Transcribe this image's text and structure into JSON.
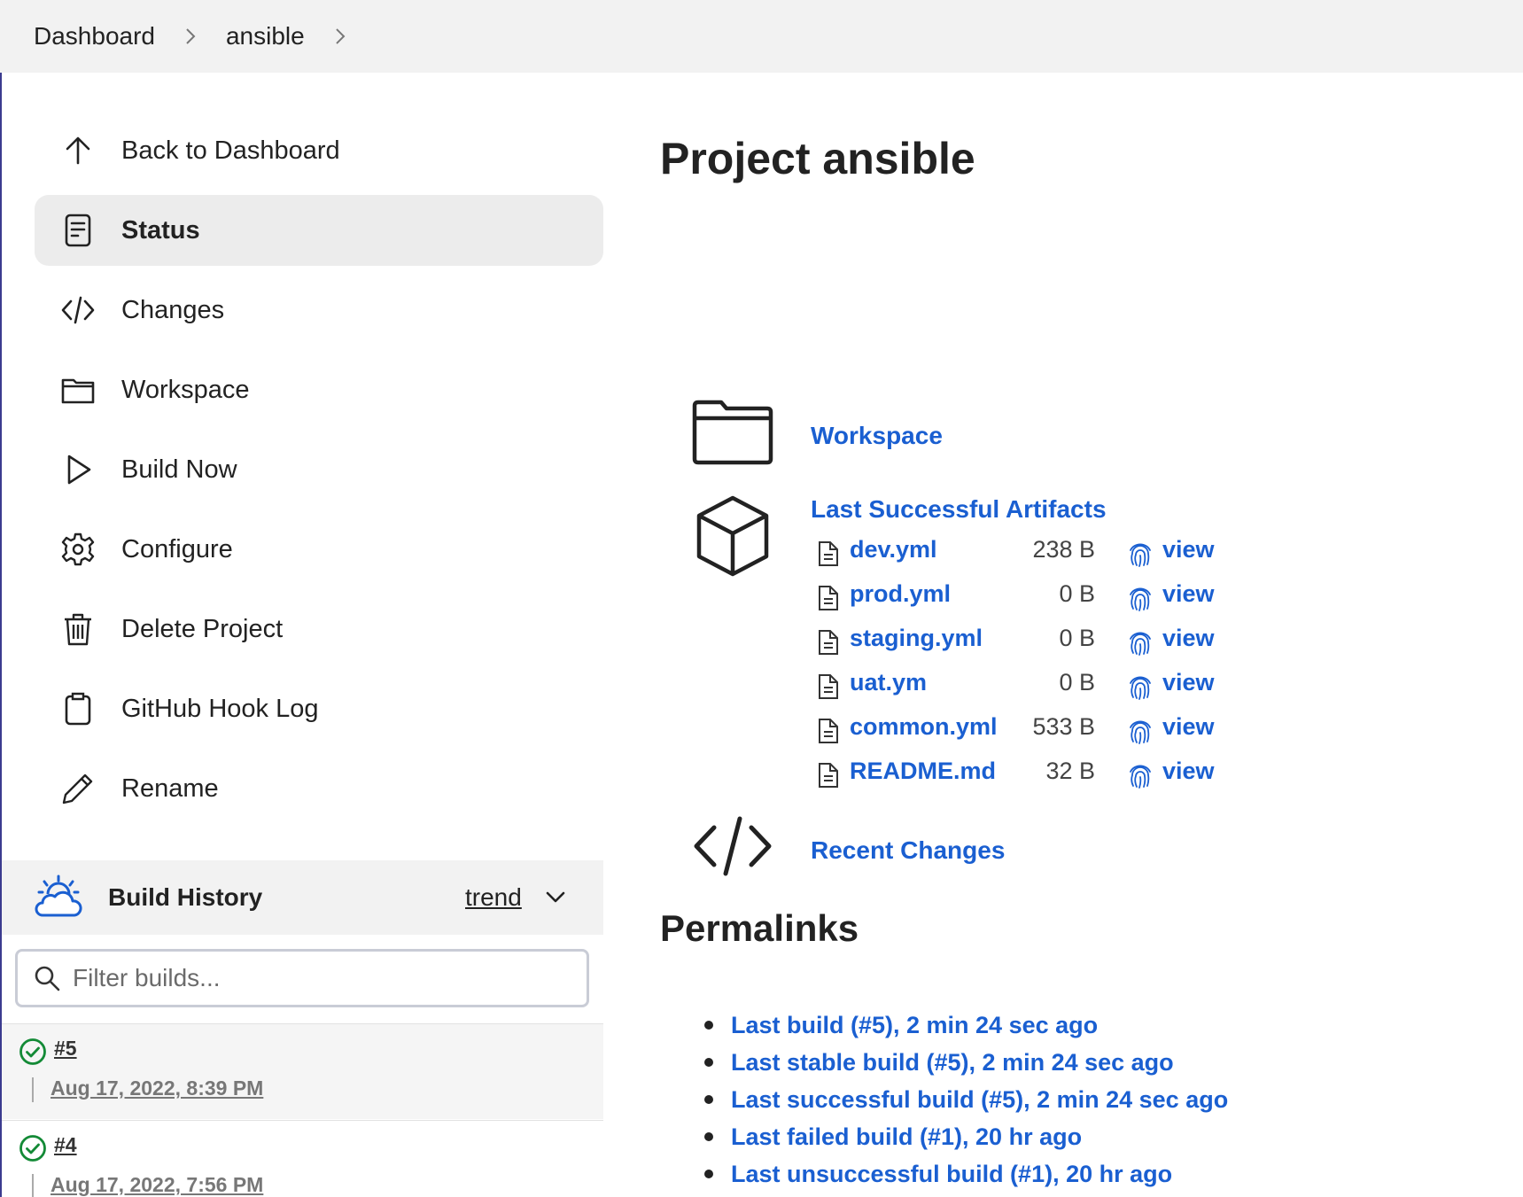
{
  "breadcrumb": {
    "items": [
      "Dashboard",
      "ansible"
    ]
  },
  "sidebar": {
    "items": [
      {
        "label": "Back to Dashboard",
        "icon": "arrow-up-icon"
      },
      {
        "label": "Status",
        "icon": "document-icon",
        "active": true
      },
      {
        "label": "Changes",
        "icon": "code-icon"
      },
      {
        "label": "Workspace",
        "icon": "folder-icon"
      },
      {
        "label": "Build Now",
        "icon": "play-icon"
      },
      {
        "label": "Configure",
        "icon": "gear-icon"
      },
      {
        "label": "Delete Project",
        "icon": "trash-icon"
      },
      {
        "label": "GitHub Hook Log",
        "icon": "clipboard-icon"
      },
      {
        "label": "Rename",
        "icon": "pencil-icon"
      }
    ]
  },
  "build_history": {
    "title": "Build History",
    "trend_label": "trend",
    "filter_placeholder": "Filter builds...",
    "builds": [
      {
        "number": "#5",
        "date": "Aug 17, 2022, 8:39 PM",
        "status": "success"
      },
      {
        "number": "#4",
        "date": "Aug 17, 2022, 7:56 PM",
        "status": "success"
      }
    ]
  },
  "main": {
    "title": "Project ansible",
    "workspace_label": "Workspace",
    "artifacts_title": "Last Successful Artifacts",
    "artifacts": [
      {
        "name": "dev.yml",
        "size": "238 B",
        "view": "view"
      },
      {
        "name": "prod.yml",
        "size": "0 B",
        "view": "view"
      },
      {
        "name": "staging.yml",
        "size": "0 B",
        "view": "view"
      },
      {
        "name": "uat.ym",
        "size": "0 B",
        "view": "view"
      },
      {
        "name": "common.yml",
        "size": "533 B",
        "view": "view"
      },
      {
        "name": "README.md",
        "size": "32 B",
        "view": "view"
      }
    ],
    "recent_changes_label": "Recent Changes",
    "permalinks_title": "Permalinks",
    "permalinks": [
      "Last build (#5), 2 min 24 sec ago",
      "Last stable build (#5), 2 min 24 sec ago",
      "Last successful build (#5), 2 min 24 sec ago",
      "Last failed build (#1), 20 hr ago",
      "Last unsuccessful build (#1), 20 hr ago"
    ]
  },
  "colors": {
    "link": "#1a5fd1",
    "success": "#138a36",
    "weather_icon": "#1a5fd1"
  }
}
